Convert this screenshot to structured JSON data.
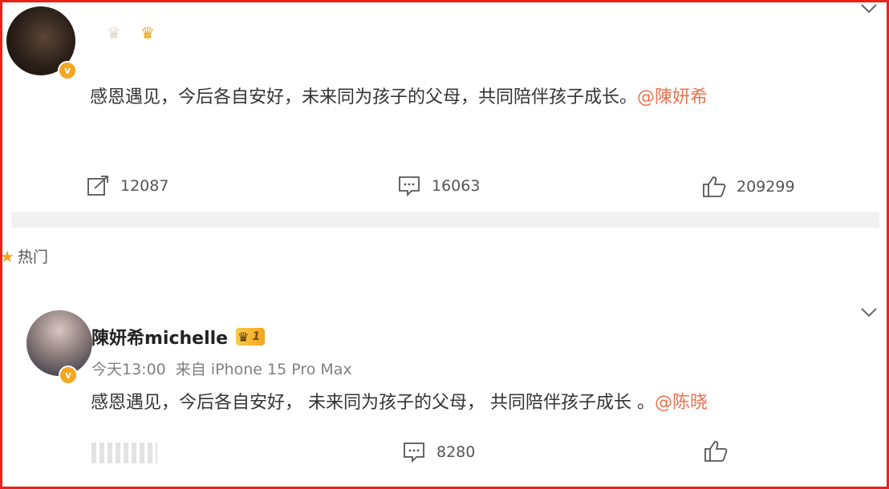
{
  "post1": {
    "content_text": "感恩遇见，今后各自安好，未来同为孩子的父母，共同陪伴孩子成长。",
    "mention": "@陳妍希",
    "verify_mark": "v",
    "actions": {
      "repost_count": "12087",
      "comment_count": "16063",
      "like_count": "209299"
    }
  },
  "section": {
    "hot_label": "热门"
  },
  "post2": {
    "username": "陳妍希michelle",
    "vip_level": "1",
    "time": "今天13:00",
    "source": "来自 iPhone 15 Pro Max",
    "content_text": "感恩遇见，今后各自安好，  未来同为孩子的父母，  共同陪伴孩子成长 。",
    "mention": "@陈晓",
    "verify_mark": "v",
    "actions": {
      "comment_count": "8280"
    }
  },
  "colors": {
    "frame": "#e8231a",
    "mention": "#eb7350",
    "verify": "#f5a623"
  }
}
